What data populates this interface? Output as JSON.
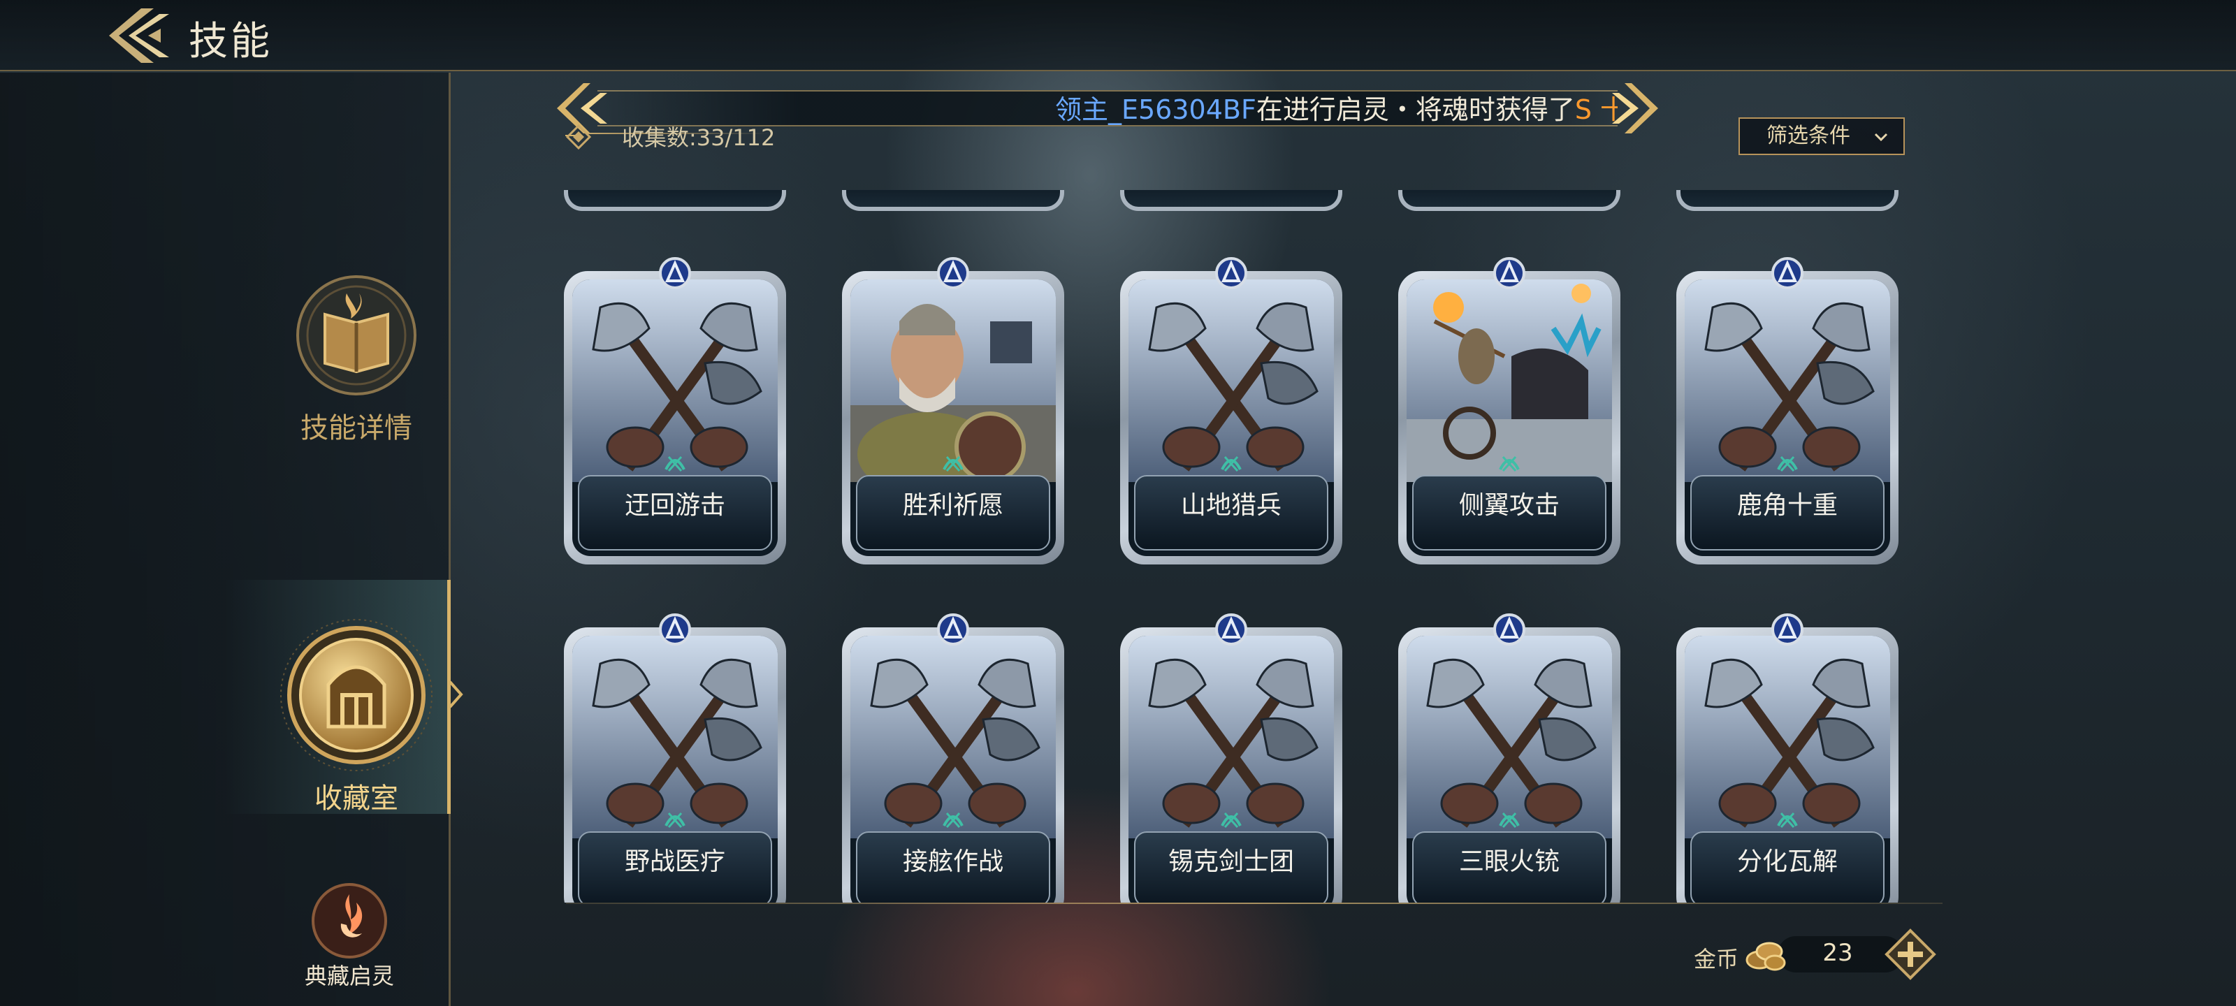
{
  "header": {
    "title": "技能"
  },
  "sidebar": {
    "items": [
      {
        "label": "技能详情",
        "icon": "skill-book-icon"
      },
      {
        "label": "收藏室",
        "icon": "collection-emblem-icon"
      },
      {
        "label": "典藏启灵",
        "icon": "flame-spirit-icon"
      }
    ],
    "active_index": 1
  },
  "ticker": {
    "player": "领主_E56304BF",
    "message": "在进行启灵・将魂时获得了",
    "item": "S 十字军"
  },
  "collection": {
    "count_label": "收集数:33/112"
  },
  "filter": {
    "label": "筛选条件"
  },
  "cards": [
    {
      "name": "迂回游击",
      "art": "crossed-axes"
    },
    {
      "name": "胜利祈愿",
      "art": "armored-warrior"
    },
    {
      "name": "山地猎兵",
      "art": "crossed-axes"
    },
    {
      "name": "侧翼攻击",
      "art": "chariot-archer"
    },
    {
      "name": "鹿角十重",
      "art": "crossed-axes"
    },
    {
      "name": "野战医疗",
      "art": "crossed-axes"
    },
    {
      "name": "接舷作战",
      "art": "crossed-axes"
    },
    {
      "name": "锡克剑士团",
      "art": "crossed-axes"
    },
    {
      "name": "三眼火铳",
      "art": "crossed-axes"
    },
    {
      "name": "分化瓦解",
      "art": "crossed-axes"
    }
  ],
  "currency": {
    "label": "金币",
    "value": "23"
  },
  "colors": {
    "gold": "#d8b46a",
    "player": "#6aa8ff",
    "item": "#ff9a2e"
  }
}
